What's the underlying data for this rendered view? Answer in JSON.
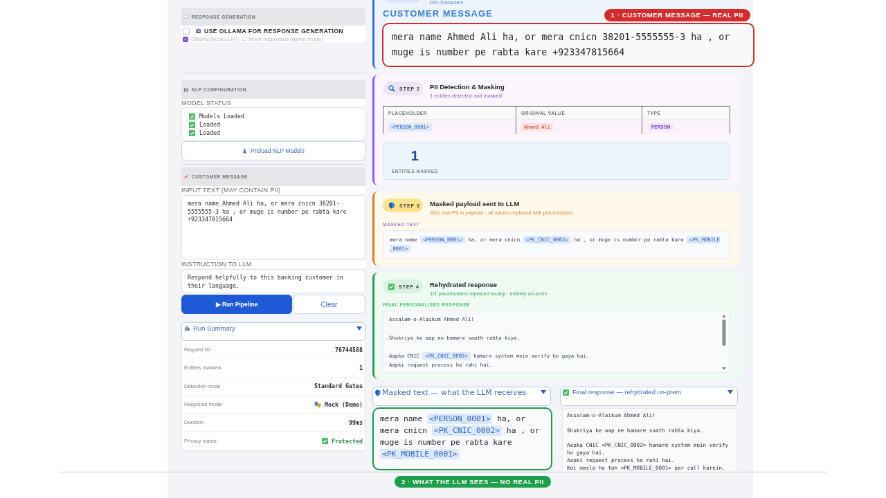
{
  "settings_panel": {
    "response_generation": {
      "title": "RESPONSE GENERATION",
      "ollama_toggle": {
        "label": "USE OLLAMA FOR RESPONSE GENERATION",
        "checked": false
      },
      "mode_option": {
        "label": "Ollama (local LLM) | ☐ Mock responses (demo mode)",
        "checked": true
      }
    },
    "nlp_configuration": {
      "title": "NLP CONFIGURATION",
      "status_label": "MODEL STATUS",
      "models": [
        {
          "label": "Models Loaded",
          "checked": true
        },
        {
          "label": "Loaded",
          "checked": true
        },
        {
          "label": "Loaded",
          "checked": true
        }
      ],
      "preload_button": "Preload NLP Models"
    },
    "customer_message": {
      "title": "CUSTOMER MESSAGE",
      "input_label": "INPUT TEXT (MAY CONTAIN PII)",
      "input_value": "mera name Ahmed Ali ha, or mera cnicn 38201-5555555-3 ha , or muge is number pe rabta kare +923347815664",
      "instruction_label": "INSTRUCTION TO LLM",
      "instruction_value": "Respond helpfully to this banking customer in their language.",
      "buttons": [
        {
          "label": "▶ Run Pipeline",
          "kind": "primary"
        },
        {
          "label": "Clear",
          "kind": "secondary"
        }
      ]
    },
    "run_summary": {
      "title": "Run Summary",
      "expanded": true,
      "rows": [
        {
          "label": "Request ID",
          "value": "76744588",
          "kind": "plain"
        },
        {
          "label": "Entities masked",
          "value": "1",
          "kind": "plain"
        },
        {
          "label": "Detection mode",
          "value": "Standard Gates",
          "kind": "plain"
        },
        {
          "label": "Response mode",
          "value": "Mock (Demo)",
          "kind": "mode"
        },
        {
          "label": "Duration",
          "value": "99ms",
          "kind": "plain"
        },
        {
          "label": "Privacy status",
          "value": "Protected",
          "kind": "status"
        }
      ]
    }
  },
  "pipeline": {
    "input_step": {
      "meta": "104 characters",
      "heading": "CUSTOMER MESSAGE",
      "message": "mera name Ahmed Ali ha, or mera cnicn 38201-5555555-3 ha , or muge is number pe rabta kare +923347815664",
      "annotation": "1 · CUSTOMER MESSAGE — REAL PII"
    },
    "detection_step": {
      "badge": "STEP 2",
      "title": "PII Detection & Masking",
      "subtitle": "1 entities detected and masked",
      "table": {
        "columns": [
          "PLACEHOLDER",
          "ORIGINAL VALUE",
          "TYPE"
        ],
        "rows": [
          [
            {
              "text": "<PERSON_0001>",
              "kind": "placeholder"
            },
            {
              "text": "Ahmed Ali",
              "kind": "original"
            },
            {
              "text": "PERSON",
              "kind": "entity_type"
            }
          ]
        ]
      },
      "stat": {
        "value": "1",
        "label": "ENTITIES MASKED"
      }
    },
    "payload_step": {
      "badge": "STEP 3",
      "title": "Masked payload sent to LLM",
      "subtitle": "Zero real PII in payload · all values replaced with placeholders",
      "label": "MASKED TEXT",
      "segments": [
        {
          "text": "mera name ",
          "kind": "text"
        },
        {
          "text": "<PERSON_0001>",
          "kind": "placeholder"
        },
        {
          "text": " ha, or mera cnicn ",
          "kind": "text"
        },
        {
          "text": "<PK_CNIC_0002>",
          "kind": "placeholder"
        },
        {
          "text": " ha , or muge is number pe rabta kare ",
          "kind": "text"
        },
        {
          "text": "<PK_MOBILE_0001>",
          "kind": "placeholder"
        }
      ]
    },
    "response_step": {
      "badge": "STEP 4",
      "title": "Rehydrated response",
      "subtitle": "1/1 placeholders replaced locally · entirely on-prem",
      "label": "FINAL PERSONALISED RESPONSE",
      "paragraphs": [
        {
          "lines": [
            [
              {
                "text": "Assalam-o-Alaikum Ahmed Ali!",
                "kind": "text"
              }
            ]
          ]
        },
        {
          "lines": [
            [
              {
                "text": "Shukriya ke aap ne hamare saath rabta kiya.",
                "kind": "text"
              }
            ]
          ]
        },
        {
          "lines": [
            [
              {
                "text": "Aapka CNIC ",
                "kind": "text"
              },
              {
                "text": "<PK_CNIC_0002>",
                "kind": "placeholder"
              },
              {
                "text": " hamare system mein verify ho gaya hai.",
                "kind": "text"
              }
            ],
            [
              {
                "text": "Aapki request process ho rahi hai.",
                "kind": "text"
              }
            ]
          ]
        }
      ]
    }
  },
  "views": [
    {
      "kind": "masked",
      "title": "Masked text — what the LLM receives",
      "expanded": true,
      "segments": [
        {
          "text": "mera name ",
          "kind": "text"
        },
        {
          "text": "<PERSON_0001>",
          "kind": "placeholder"
        },
        {
          "text": " ha, or mera cnicn ",
          "kind": "text"
        },
        {
          "text": "<PK_CNIC_0002>",
          "kind": "placeholder"
        },
        {
          "text": " ha , or muge is number pe rabta kare ",
          "kind": "text"
        },
        {
          "text": "<PK_MOBILE_0001>",
          "kind": "placeholder"
        }
      ],
      "annotation": "2 · WHAT THE LLM SEES — NO REAL PII"
    },
    {
      "kind": "final",
      "title": "Final response — rehydrated on-prem",
      "expanded": true,
      "paragraphs": [
        {
          "lines": [
            "Assalam-o-Alaikum Ahmed Ali!"
          ]
        },
        {
          "lines": [
            "Shukriya ke aap ne hamare saath rabta kiya."
          ]
        },
        {
          "lines": [
            "Aapka CNIC <PK_CNIC_0002> hamare system mein verify ho gaya hai.",
            "Aapki request process ho rahi hai.",
            "Koi masla ho toh <PK_MOBILE_0001> par call karein."
          ]
        }
      ]
    }
  ]
}
